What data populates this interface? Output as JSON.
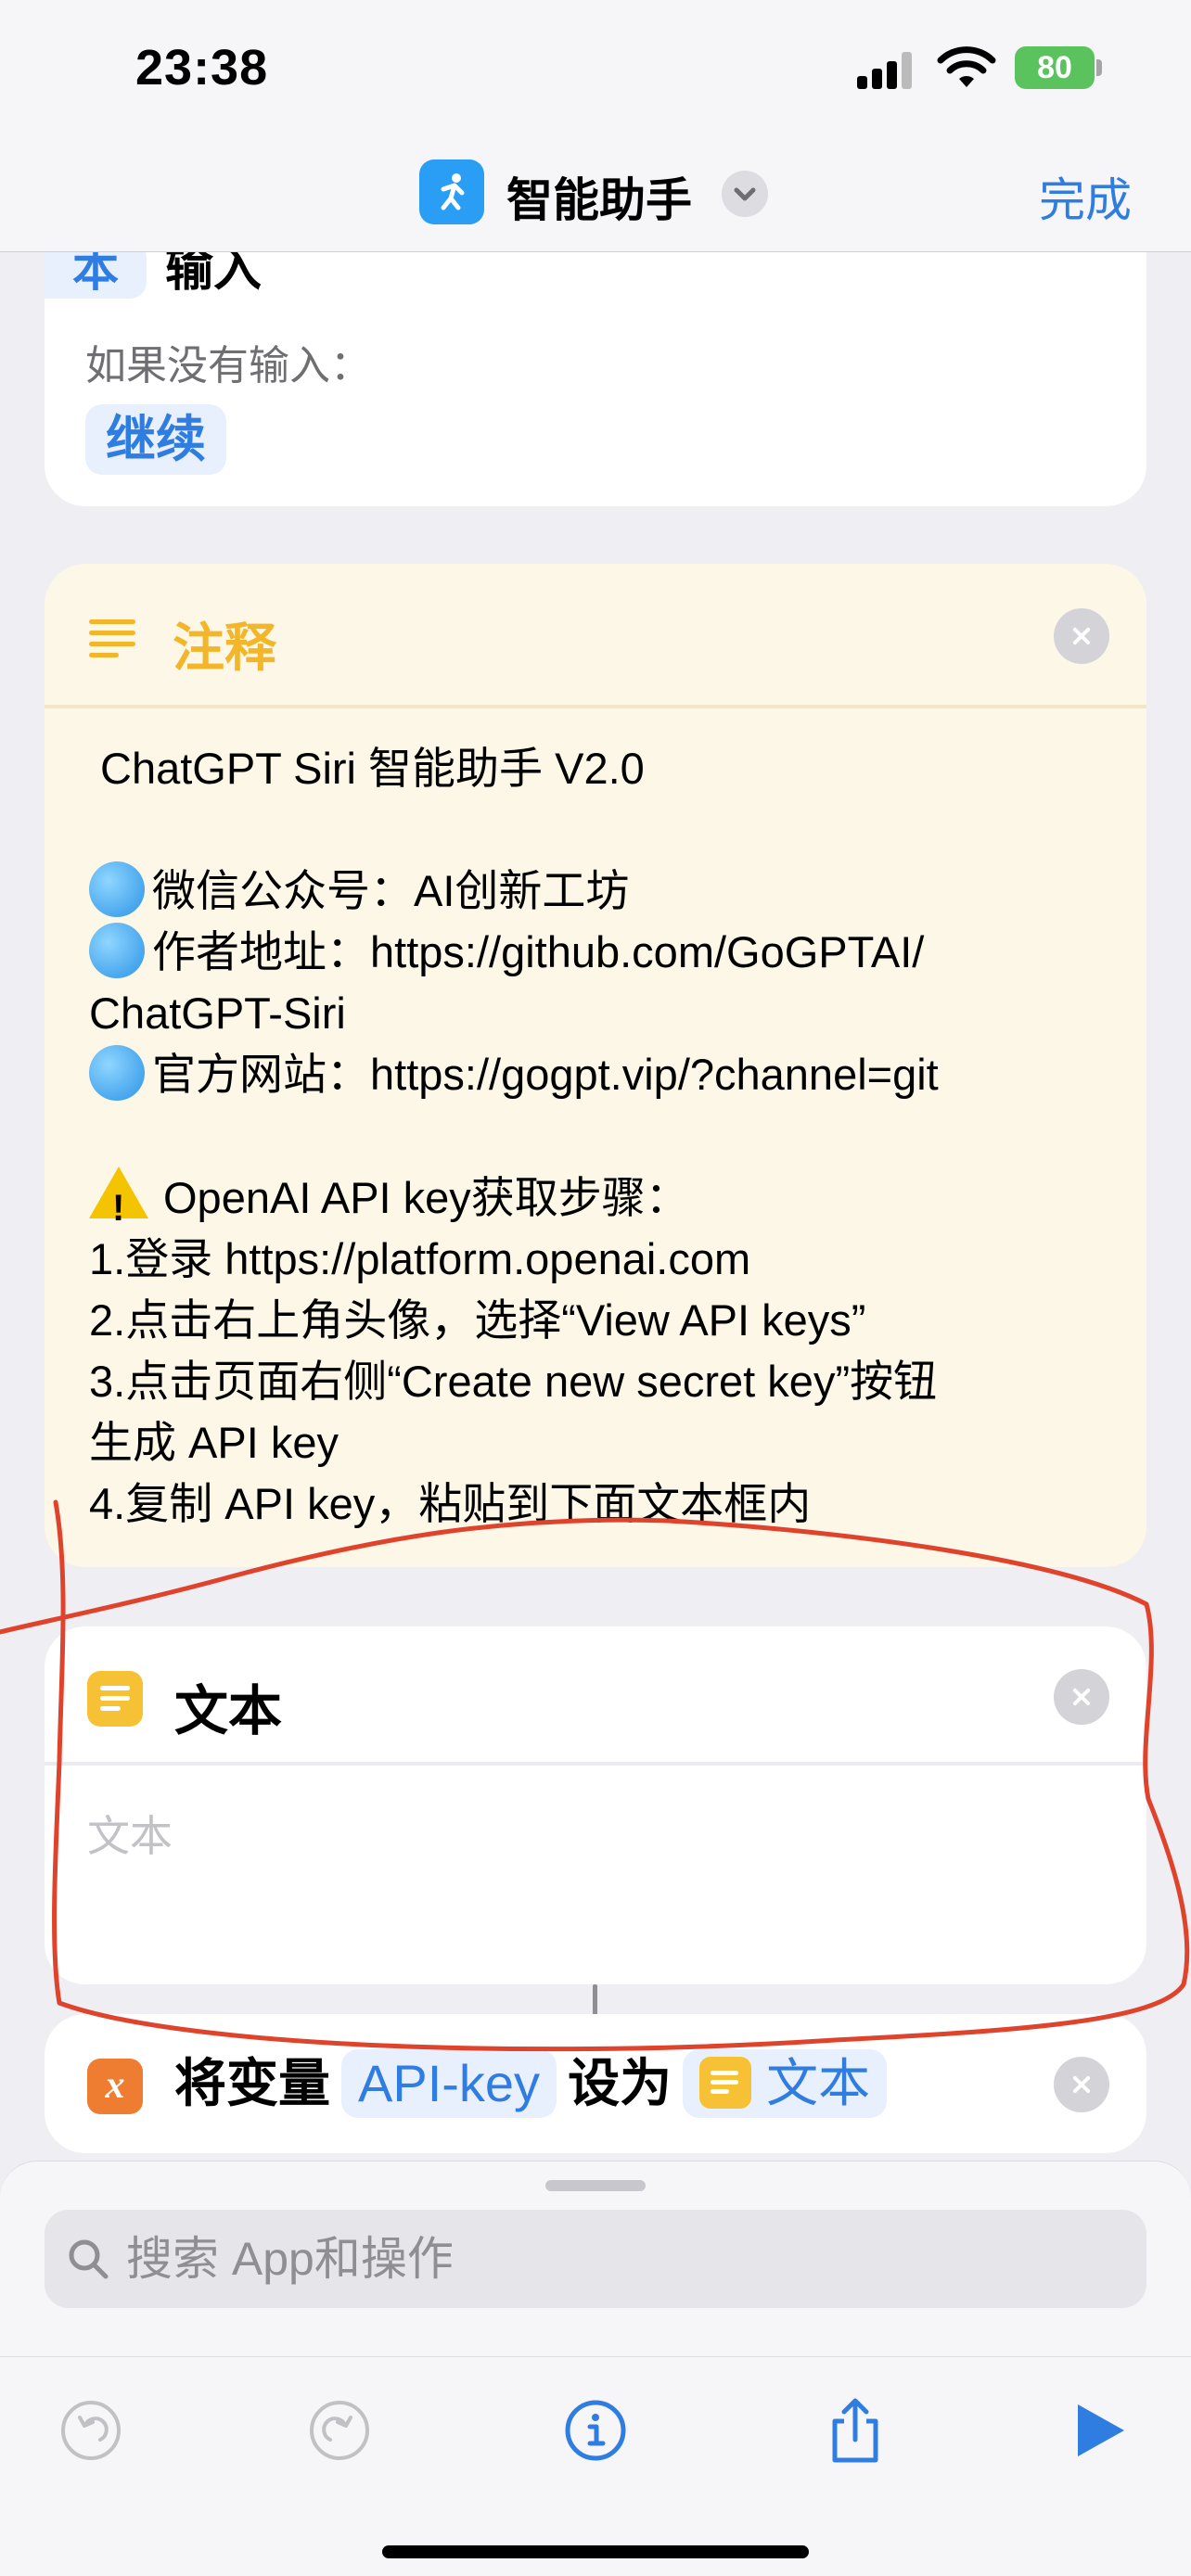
{
  "status_bar": {
    "time": "23:38",
    "battery": "80"
  },
  "nav": {
    "title": "智能助手",
    "done": "完成"
  },
  "input_card": {
    "chip": "本",
    "word": "输入",
    "if_no_input": "如果没有输入：",
    "continue": "继续"
  },
  "comment_card": {
    "title": "注释",
    "lines": [
      "ChatGPT Siri 智能助手 V2.0",
      "",
      "微信公众号：AI创新工坊",
      "作者地址：https://github.com/GoGPTAI/",
      "ChatGPT-Siri",
      "官方网站：https://gogpt.vip/?channel=git",
      "",
      "OpenAI API key获取步骤：",
      "1.登录 https://platform.openai.com",
      "2.点击右上角头像，选择“View API keys”",
      "3.点击页面右侧“Create new secret key”按钮",
      "生成 API key",
      "4.复制 API key，粘贴到下面文本框内"
    ]
  },
  "text_card": {
    "title": "文本",
    "placeholder": "文本"
  },
  "variable_card": {
    "prefix": "将变量",
    "variable": "API-key",
    "middle": "设为",
    "value": "文本"
  },
  "search": {
    "placeholder": "搜索 App和操作"
  },
  "colors": {
    "accent": "#2f7de1",
    "comment": "#f3b52a",
    "annotation": "#e0432c"
  },
  "icons": [
    "run-icon",
    "chevron-down-icon",
    "lines-icon",
    "close-icon",
    "doc-icon",
    "variable-icon",
    "search-icon",
    "undo-icon",
    "redo-icon",
    "info-icon",
    "share-icon",
    "play-icon"
  ]
}
